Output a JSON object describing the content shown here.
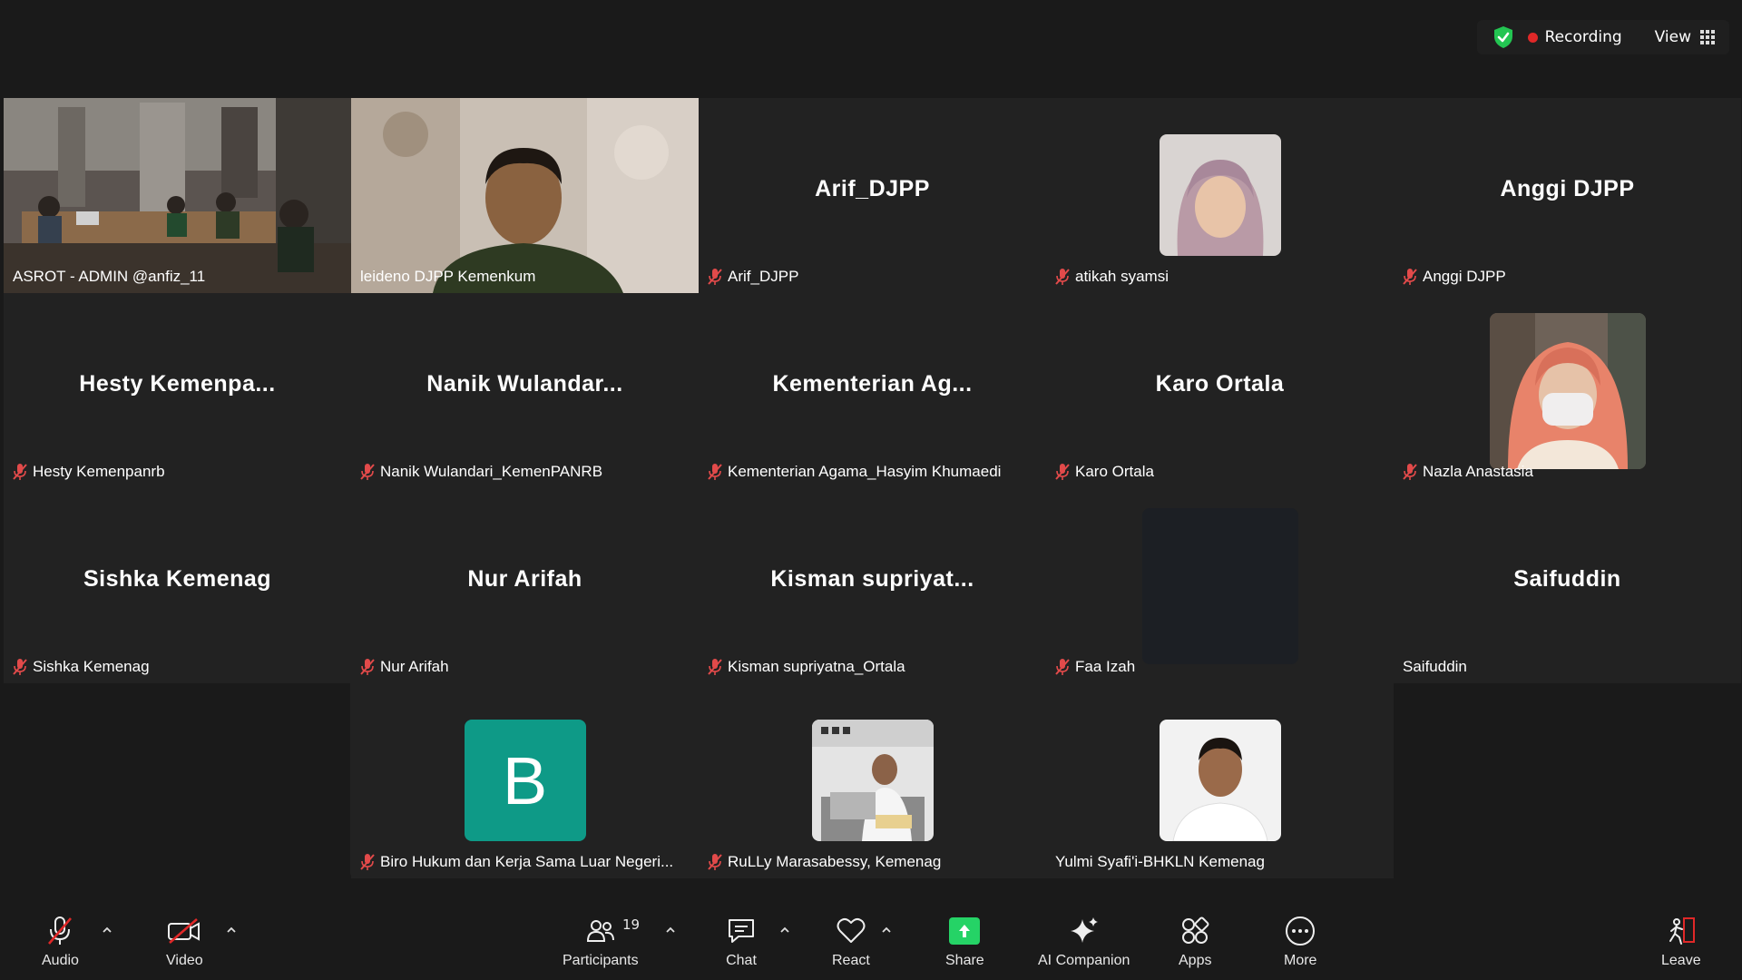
{
  "top": {
    "recording_label": "Recording",
    "view_label": "View",
    "shield_color": "#23c552",
    "recording_color": "#e02828"
  },
  "tiles": [
    {
      "id": "t1",
      "label": "ASROT - ADMIN @anfiz_11",
      "video": true
    },
    {
      "id": "t2",
      "label": "leideno DJPP Kemenkum",
      "video": true,
      "active_speaker": true
    },
    {
      "id": "t3",
      "label": "Arif_DJPP",
      "bigname": "Arif_DJPP",
      "muted": true
    },
    {
      "id": "t4",
      "label": "atikah syamsi",
      "muted": true,
      "photo": true
    },
    {
      "id": "t5",
      "label": "Anggi DJPP",
      "bigname": "Anggi DJPP",
      "muted": true
    },
    {
      "id": "t6",
      "label": "Hesty Kemenpanrb",
      "bigname": "Hesty  Kemenpa...",
      "muted": true
    },
    {
      "id": "t7",
      "label": "Nanik Wulandari_KemenPANRB",
      "bigname": "Nanik  Wulandar...",
      "muted": true
    },
    {
      "id": "t8",
      "label": "Kementerian Agama_Hasyim Khumaedi",
      "bigname": "Kementerian  Ag...",
      "muted": true
    },
    {
      "id": "t9",
      "label": "Karo Ortala",
      "bigname": "Karo Ortala",
      "muted": true
    },
    {
      "id": "t10",
      "label": "Nazla Anastasia",
      "muted": true,
      "photo": true
    },
    {
      "id": "t11",
      "label": "Sishka Kemenag",
      "bigname": "Sishka Kemenag",
      "muted": true
    },
    {
      "id": "t12",
      "label": "Nur Arifah",
      "bigname": "Nur Arifah",
      "muted": true
    },
    {
      "id": "t13",
      "label": "Kisman supriyatna_Ortala",
      "bigname": "Kisman  supriyat...",
      "muted": true
    },
    {
      "id": "t14",
      "label": "Faa Izah",
      "muted": true,
      "photo": true
    },
    {
      "id": "t15",
      "label": "Saifuddin",
      "bigname": "Saifuddin",
      "muted": false
    },
    {
      "id": "t16",
      "label": "Biro Hukum dan Kerja Sama Luar Negeri...",
      "muted": true,
      "avatar_letter": "B"
    },
    {
      "id": "t17",
      "label": "RuLLy Marasabessy, Kemenag",
      "muted": true,
      "photo": true
    },
    {
      "id": "t18",
      "label": "Yulmi Syafi'i-BHKLN Kemenag",
      "muted": false,
      "photo": true
    }
  ],
  "toolbar": {
    "audio_label": "Audio",
    "video_label": "Video",
    "participants_label": "Participants",
    "participants_count": "19",
    "chat_label": "Chat",
    "react_label": "React",
    "share_label": "Share",
    "ai_label": "AI Companion",
    "apps_label": "Apps",
    "more_label": "More",
    "leave_label": "Leave",
    "share_color": "#25d366",
    "leave_color": "#e02828"
  }
}
